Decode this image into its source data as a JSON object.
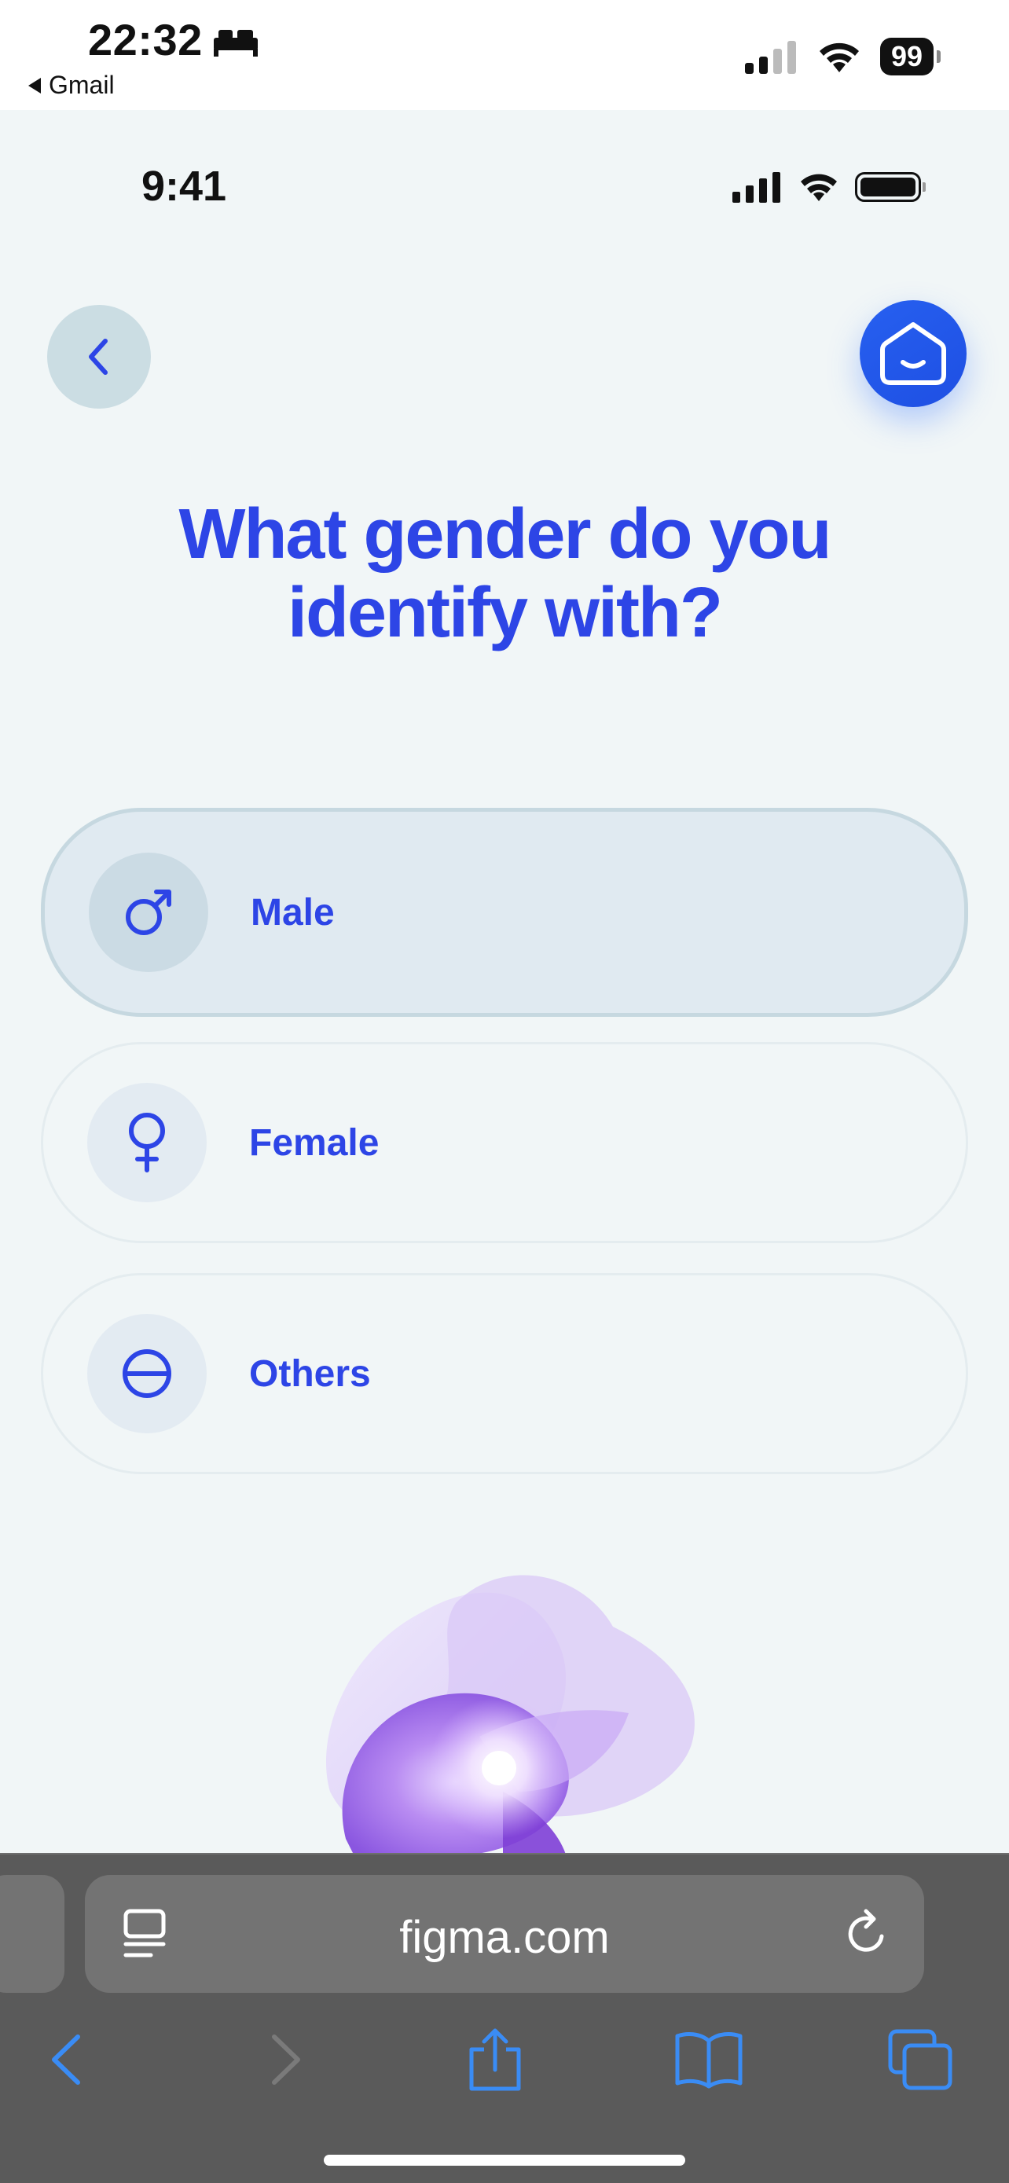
{
  "device_status": {
    "time": "22:32",
    "back_app": "Gmail",
    "battery": "99"
  },
  "mock_status": {
    "time": "9:41"
  },
  "title": {
    "line1": "What gender do you",
    "line2": "identify with?"
  },
  "options": [
    {
      "label": "Male",
      "icon": "male-symbol-icon",
      "selected": true
    },
    {
      "label": "Female",
      "icon": "female-symbol-icon",
      "selected": false
    },
    {
      "label": "Others",
      "icon": "others-symbol-icon",
      "selected": false
    }
  ],
  "browser": {
    "url": "figma.com"
  },
  "colors": {
    "accent": "#2d45e6",
    "background": "#f1f6f7",
    "selected_bg": "#e0eaf1",
    "home_button": "#1e4fe3",
    "browser_bar": "#5a5a5a"
  }
}
